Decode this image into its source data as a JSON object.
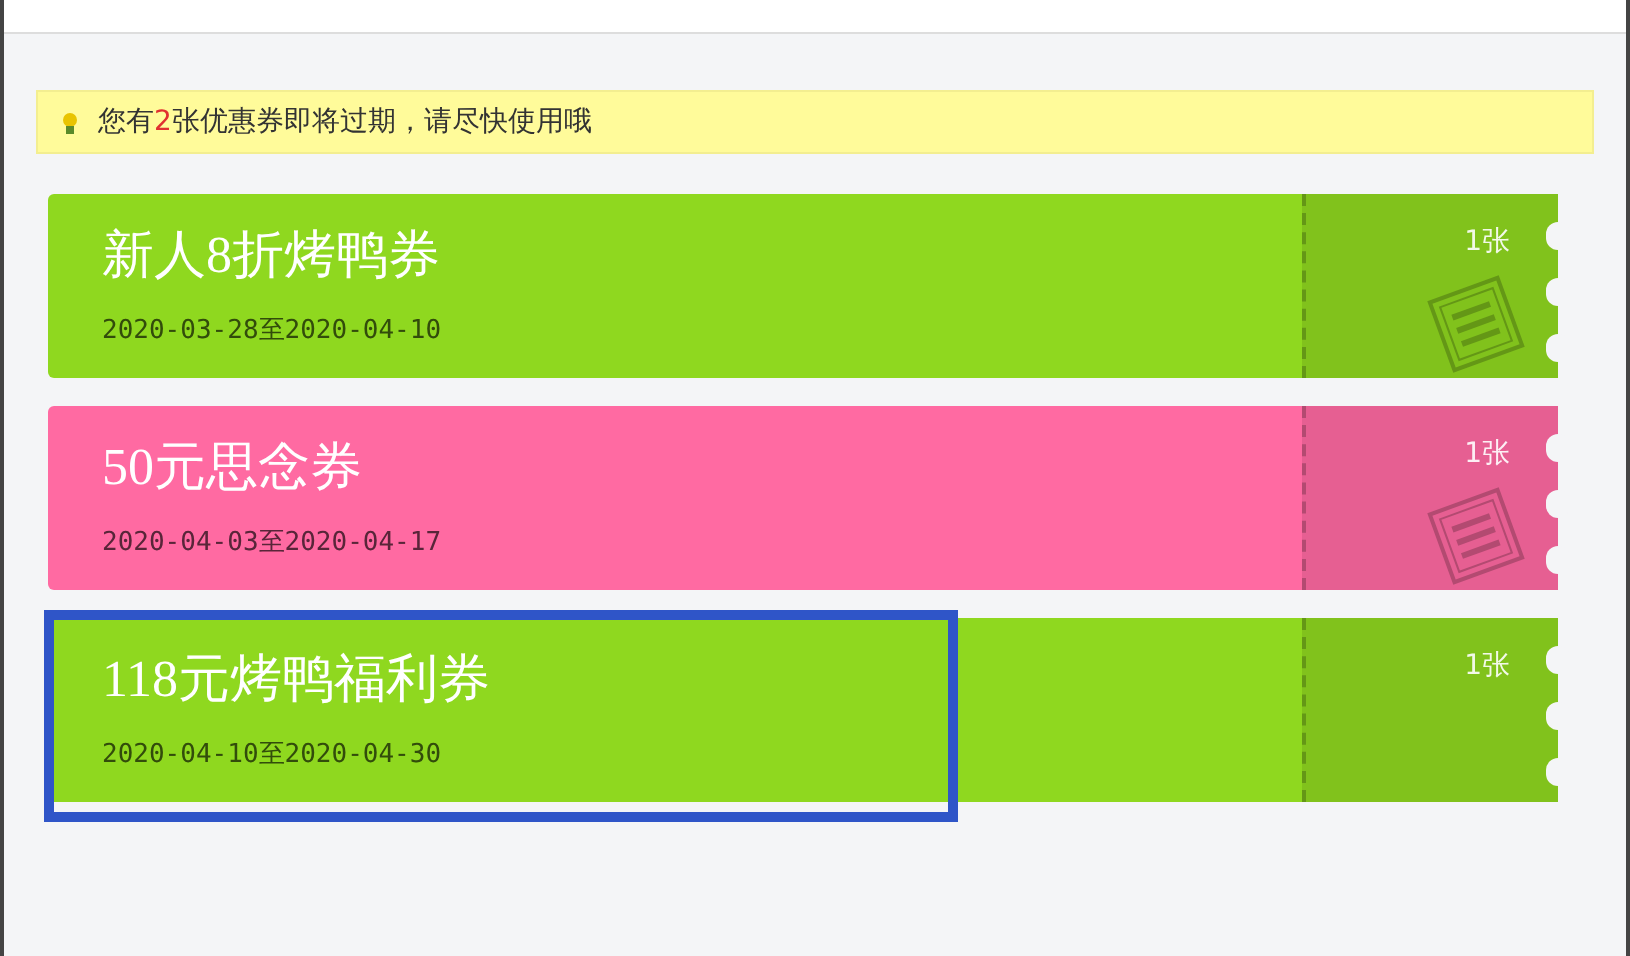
{
  "notice": {
    "text_before": "您有",
    "count": "2",
    "text_after": "张优惠券即将过期，请尽快使用哦"
  },
  "coupons": [
    {
      "title": "新人8折烤鸭券",
      "dates": "2020-03-28至2020-04-10",
      "quantity": "1张",
      "color": "#8fd81f",
      "expiring": true,
      "highlighted": false
    },
    {
      "title": "50元思念券",
      "dates": "2020-04-03至2020-04-17",
      "quantity": "1张",
      "color": "#ff6aa2",
      "expiring": true,
      "highlighted": false
    },
    {
      "title": "118元烤鸭福利券",
      "dates": "2020-04-10至2020-04-30",
      "quantity": "1张",
      "color": "#8fd81f",
      "expiring": false,
      "highlighted": true
    }
  ]
}
